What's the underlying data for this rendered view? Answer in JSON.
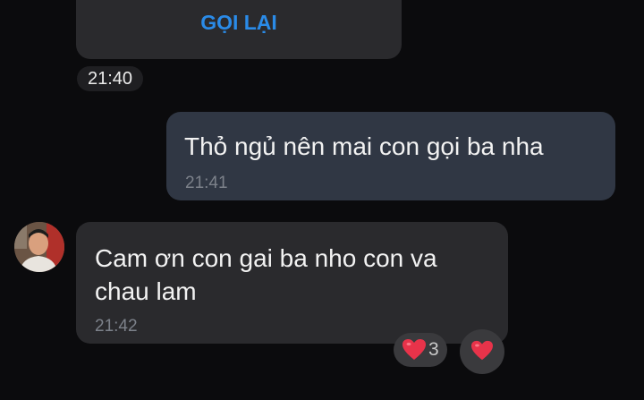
{
  "call_card": {
    "button_label": "GỌI LẠI",
    "accent_color": "#2a8be8"
  },
  "timestamp_pill": "21:40",
  "messages": [
    {
      "direction": "outgoing",
      "text": "Thỏ ngủ nên mai con gọi ba nha",
      "time": "21:41"
    },
    {
      "direction": "incoming",
      "text": "Cam ơn con gai ba nho con va chau lam",
      "time": "21:42",
      "reaction": {
        "icon": "heart-icon",
        "count": "3"
      }
    }
  ],
  "reaction_button": {
    "icon": "heart-icon"
  },
  "colors": {
    "background": "#0b0b0d",
    "incoming_bubble": "#2a2a2d",
    "outgoing_bubble": "#303744",
    "heart": "#e8334a"
  }
}
